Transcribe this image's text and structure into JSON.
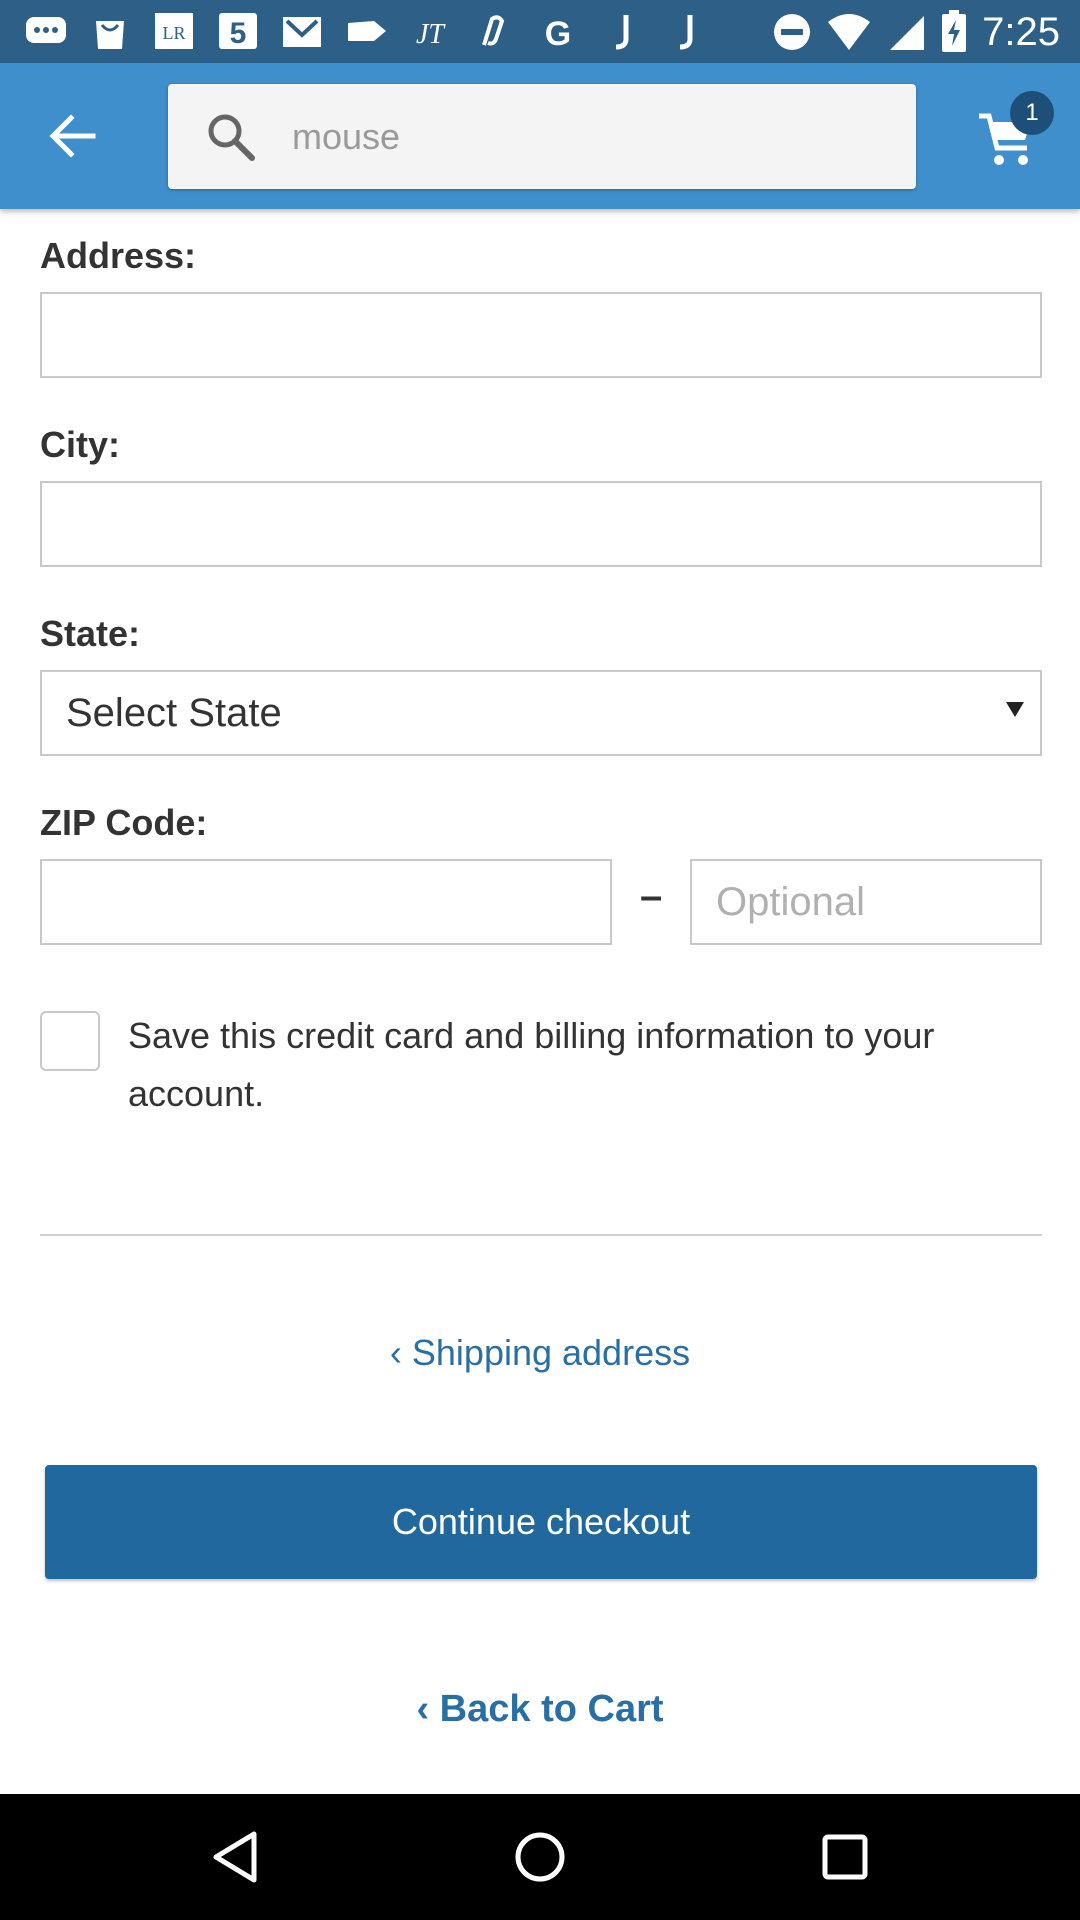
{
  "status_bar": {
    "time": "7:25",
    "left_icons": [
      "chat-icon",
      "bag-icon",
      "lr-icon",
      "five-icon",
      "gmail-icon",
      "tag-icon",
      "jt-icon",
      "link-icon",
      "g-icon",
      "j-icon",
      "j-icon"
    ],
    "right_icons": [
      "do-not-disturb-icon",
      "wifi-icon",
      "signal-icon",
      "battery-charging-icon"
    ]
  },
  "header": {
    "search_placeholder": "mouse",
    "cart_count": "1",
    "accent_color": "#3f8fcd"
  },
  "form": {
    "address_label": "Address:",
    "city_label": "City:",
    "state_label": "State:",
    "state_selected": "Select State",
    "zip_label": "ZIP Code:",
    "zip_dash": "–",
    "zip_optional_placeholder": "Optional",
    "save_card_text": "Save this credit card and billing information to your account."
  },
  "actions": {
    "shipping_link": "‹ Shipping address",
    "continue_label": "Continue checkout",
    "back_to_cart": "‹ Back to Cart",
    "button_color": "#21689f"
  }
}
